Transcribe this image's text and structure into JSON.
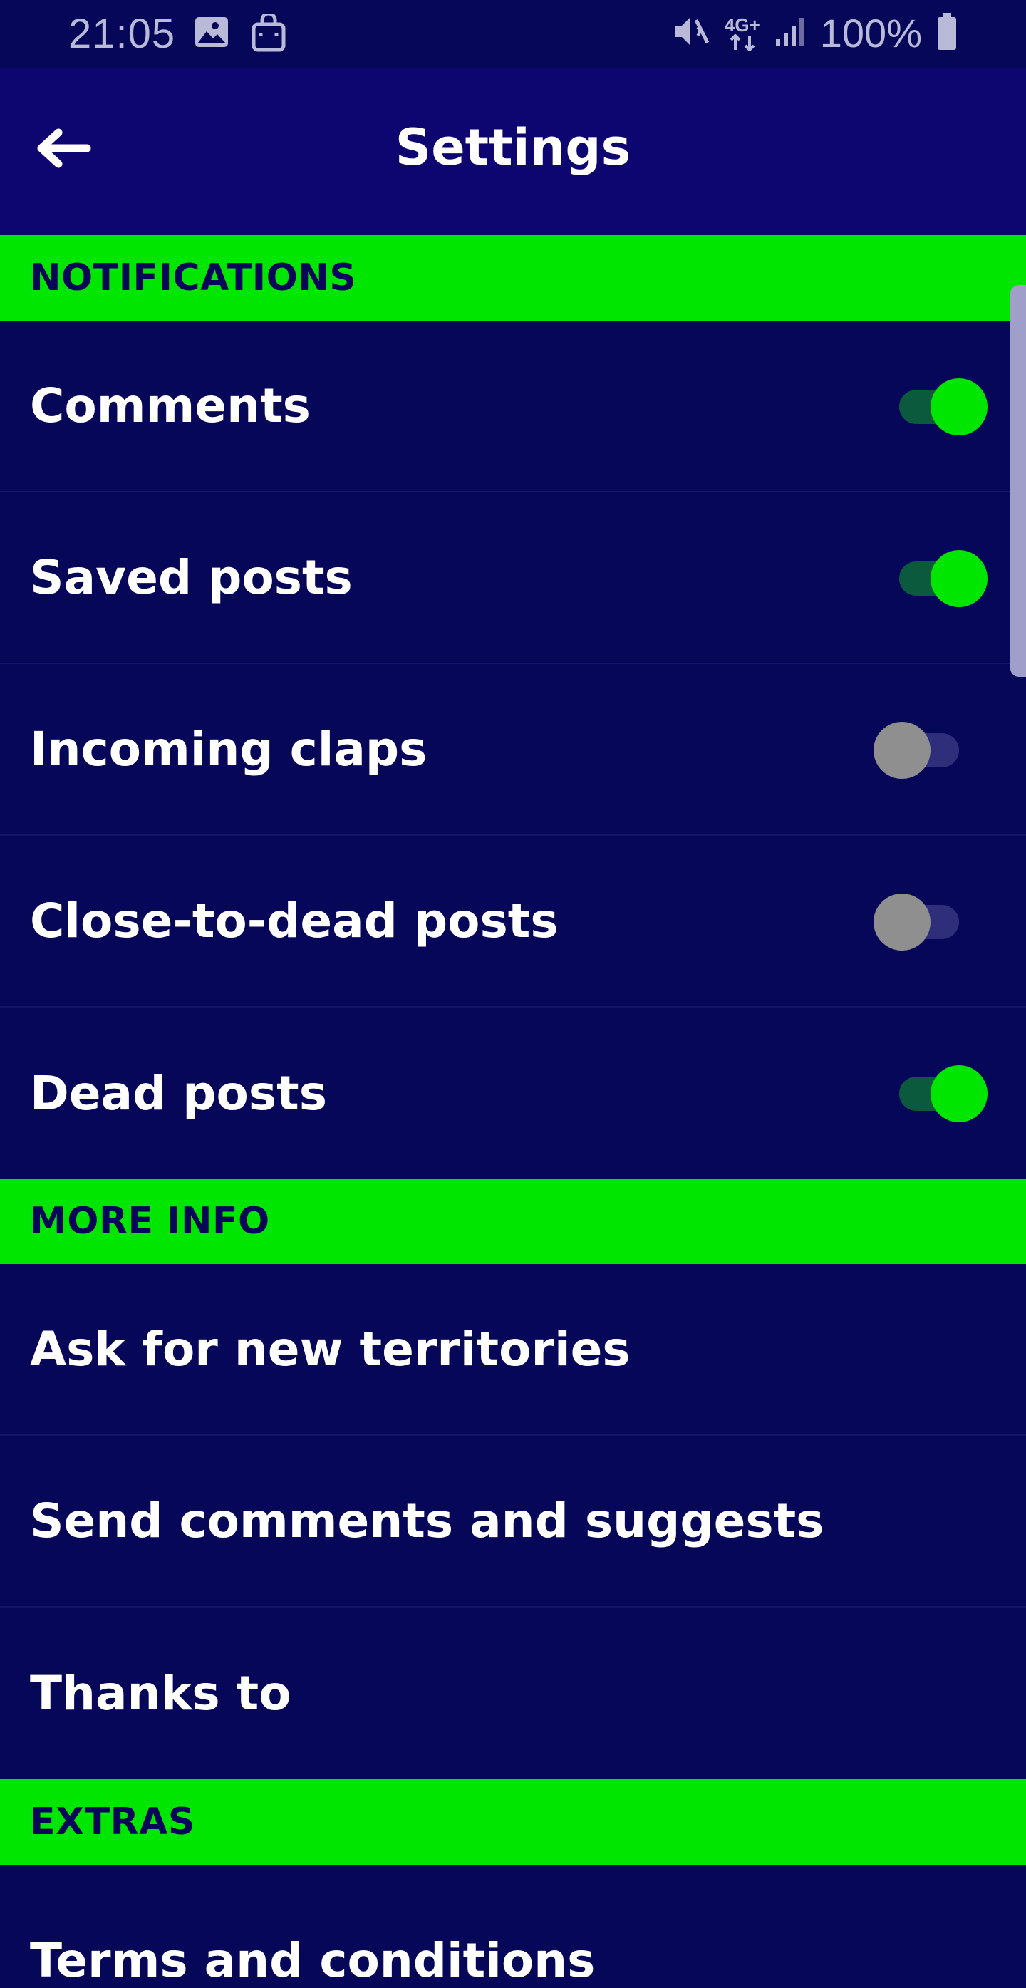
{
  "status_bar": {
    "time": "21:05",
    "network": "4G+",
    "battery": "100%"
  },
  "app_bar": {
    "title": "Settings"
  },
  "sections": {
    "notifications": {
      "title": "NOTIFICATIONS",
      "items": [
        {
          "label": "Comments",
          "enabled": true
        },
        {
          "label": "Saved posts",
          "enabled": true
        },
        {
          "label": "Incoming claps",
          "enabled": false
        },
        {
          "label": "Close-to-dead posts",
          "enabled": false
        },
        {
          "label": "Dead posts",
          "enabled": true
        }
      ]
    },
    "more_info": {
      "title": "MORE INFO",
      "items": [
        {
          "label": "Ask for new territories"
        },
        {
          "label": "Send comments and suggests"
        },
        {
          "label": "Thanks to"
        }
      ]
    },
    "extras": {
      "title": "EXTRAS",
      "items": [
        {
          "label": "Terms and conditions"
        }
      ]
    }
  },
  "colors": {
    "background": "#07075a",
    "app_bar": "#0e0670",
    "accent": "#00e600"
  }
}
